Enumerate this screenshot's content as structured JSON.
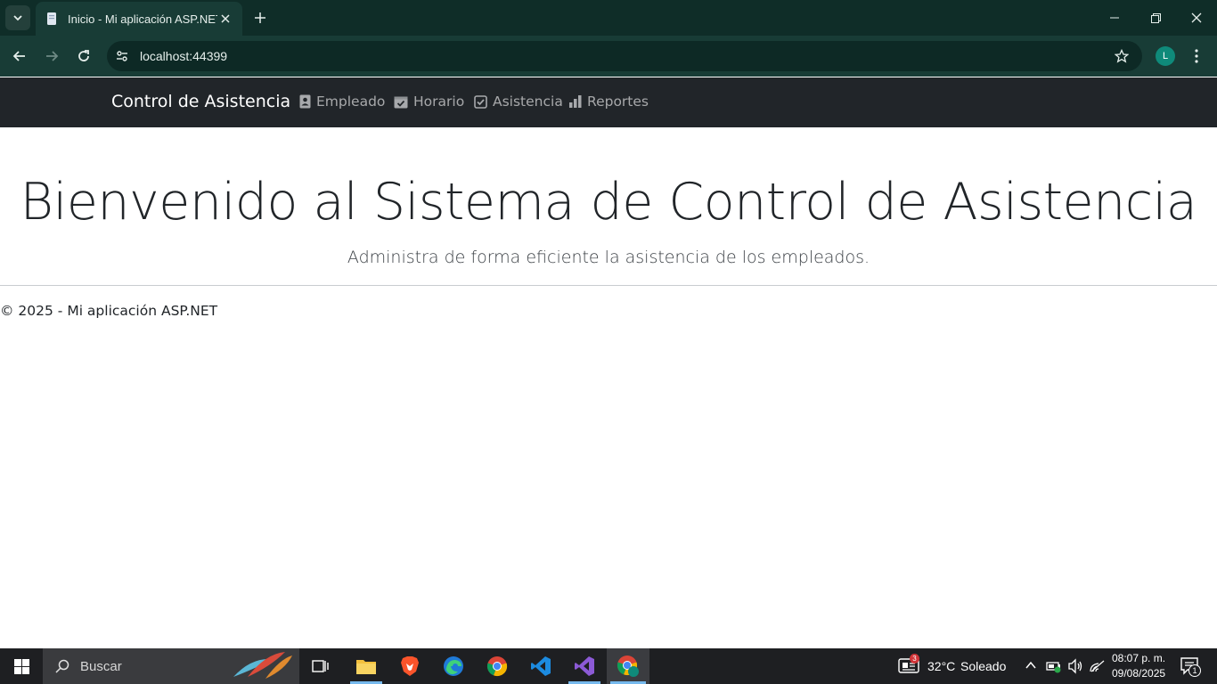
{
  "browser": {
    "tab_title": "Inicio - Mi aplicación ASP.NET",
    "url": "localhost:44399",
    "profile_initial": "L"
  },
  "navbar": {
    "brand": "Control de Asistencia",
    "links": [
      {
        "label": "Empleado",
        "icon": "id-badge-icon"
      },
      {
        "label": "Horario",
        "icon": "calendar-check-icon"
      },
      {
        "label": "Asistencia",
        "icon": "check-square-icon"
      },
      {
        "label": "Reportes",
        "icon": "bar-chart-icon"
      }
    ]
  },
  "hero": {
    "title": "Bienvenido al Sistema de Control de Asistencia",
    "subtitle": "Administra de forma eficiente la asistencia de los empleados."
  },
  "footer": {
    "text": "© 2025 - Mi aplicación ASP.NET"
  },
  "taskbar": {
    "search_placeholder": "Buscar",
    "weather_badge": "3",
    "weather_temp": "32°C",
    "weather_text": "Soleado",
    "time": "08:07 p. m.",
    "date": "09/08/2025",
    "notification_count": "1"
  },
  "colors": {
    "navbar_bg": "#212529",
    "chrome_bg": "#183c36",
    "taskbar_bg": "#1e1f22"
  }
}
